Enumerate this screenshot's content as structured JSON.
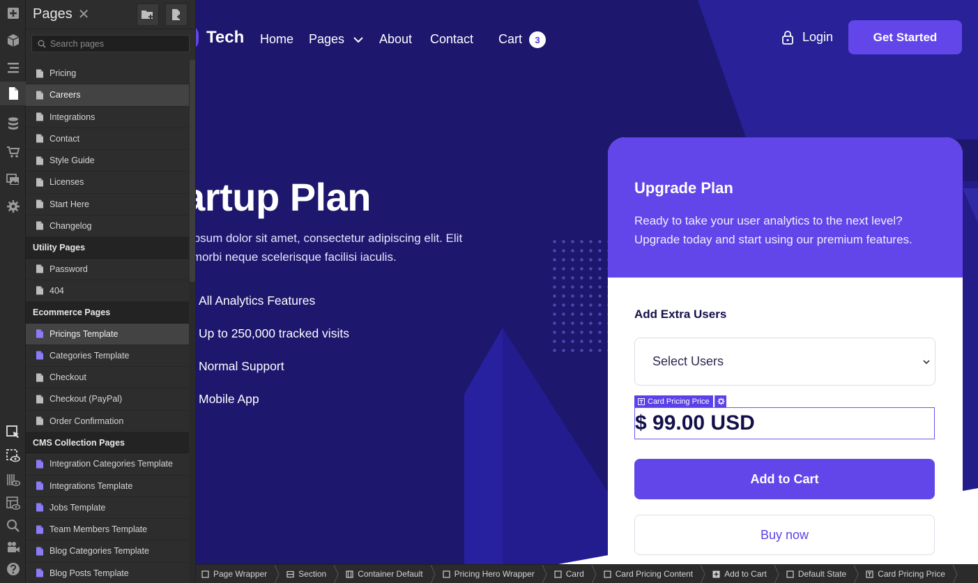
{
  "panel": {
    "title": "Pages",
    "close_glyph": "✕",
    "search_placeholder": "Search pages",
    "items": [
      {
        "type": "page",
        "label": "Pricing",
        "icon": "page-icon"
      },
      {
        "type": "page",
        "label": "Careers",
        "icon": "page-icon",
        "selected": true
      },
      {
        "type": "page",
        "label": "Integrations",
        "icon": "page-icon"
      },
      {
        "type": "page",
        "label": "Contact",
        "icon": "page-icon"
      },
      {
        "type": "page",
        "label": "Style Guide",
        "icon": "page-icon"
      },
      {
        "type": "page",
        "label": "Licenses",
        "icon": "page-icon"
      },
      {
        "type": "page",
        "label": "Start Here",
        "icon": "page-icon"
      },
      {
        "type": "page",
        "label": "Changelog",
        "icon": "page-icon"
      },
      {
        "type": "group",
        "label": "Utility Pages"
      },
      {
        "type": "page",
        "label": "Password",
        "icon": "page-icon"
      },
      {
        "type": "page",
        "label": "404",
        "icon": "page-icon"
      },
      {
        "type": "group",
        "label": "Ecommerce Pages"
      },
      {
        "type": "template",
        "label": "Pricings Template",
        "icon": "template-page-icon",
        "selected": true
      },
      {
        "type": "template",
        "label": "Categories Template",
        "icon": "template-page-icon"
      },
      {
        "type": "page",
        "label": "Checkout",
        "icon": "page-icon"
      },
      {
        "type": "page",
        "label": "Checkout (PayPal)",
        "icon": "page-icon"
      },
      {
        "type": "page",
        "label": "Order Confirmation",
        "icon": "page-icon"
      },
      {
        "type": "group",
        "label": "CMS Collection Pages"
      },
      {
        "type": "template",
        "label": "Integration Categories Template",
        "icon": "template-page-icon"
      },
      {
        "type": "template",
        "label": "Integrations Template",
        "icon": "template-page-icon"
      },
      {
        "type": "template",
        "label": "Jobs Template",
        "icon": "template-page-icon"
      },
      {
        "type": "template",
        "label": "Team Members Template",
        "icon": "template-page-icon"
      },
      {
        "type": "template",
        "label": "Blog Categories Template",
        "icon": "template-page-icon"
      },
      {
        "type": "template",
        "label": "Blog Posts Template",
        "icon": "template-page-icon"
      }
    ]
  },
  "site": {
    "brand": "Tech",
    "nav": {
      "home": "Home",
      "pages": "Pages",
      "about": "About",
      "contact": "Contact",
      "cart": "Cart",
      "cart_count": "3",
      "login": "Login",
      "get_started": "Get Started"
    },
    "hero": {
      "title": "tartup Plan",
      "desc_line1": "m ipsum dolor sit amet, consectetur adipiscing elit. Elit",
      "desc_line2": "isi morbi neque scelerisque facilisi iaculis.",
      "features": [
        "All Analytics Features",
        "Up to 250,000 tracked visits",
        "Normal Support",
        "Mobile App"
      ]
    },
    "card": {
      "title": "Upgrade Plan",
      "desc": "Ready to take your user analytics to the next level? Upgrade today and start using our premium features.",
      "extra_users_label": "Add Extra Users",
      "select_value": "Select Users",
      "selected_element_tag": "Card Pricing Price",
      "price": "$ 99.00 USD",
      "add_to_cart": "Add to Cart",
      "buy_now": "Buy now"
    }
  },
  "breadcrumb": [
    {
      "label": "Page Wrapper",
      "icon": "box-icon"
    },
    {
      "label": "Section",
      "icon": "section-icon"
    },
    {
      "label": "Container Default",
      "icon": "container-icon"
    },
    {
      "label": "Pricing Hero Wrapper",
      "icon": "box-icon"
    },
    {
      "label": "Card",
      "icon": "box-icon"
    },
    {
      "label": "Card Pricing Content",
      "icon": "box-icon"
    },
    {
      "label": "Add to Cart",
      "icon": "add-to-cart-element-icon"
    },
    {
      "label": "Default State",
      "icon": "box-icon"
    },
    {
      "label": "Card Pricing Price",
      "icon": "text-element-icon"
    }
  ],
  "colors": {
    "accent": "#6246ea",
    "canvas_bg": "#1d176e",
    "panel_bg": "#2d2d2d",
    "template_icon": "#8b7cf6"
  }
}
